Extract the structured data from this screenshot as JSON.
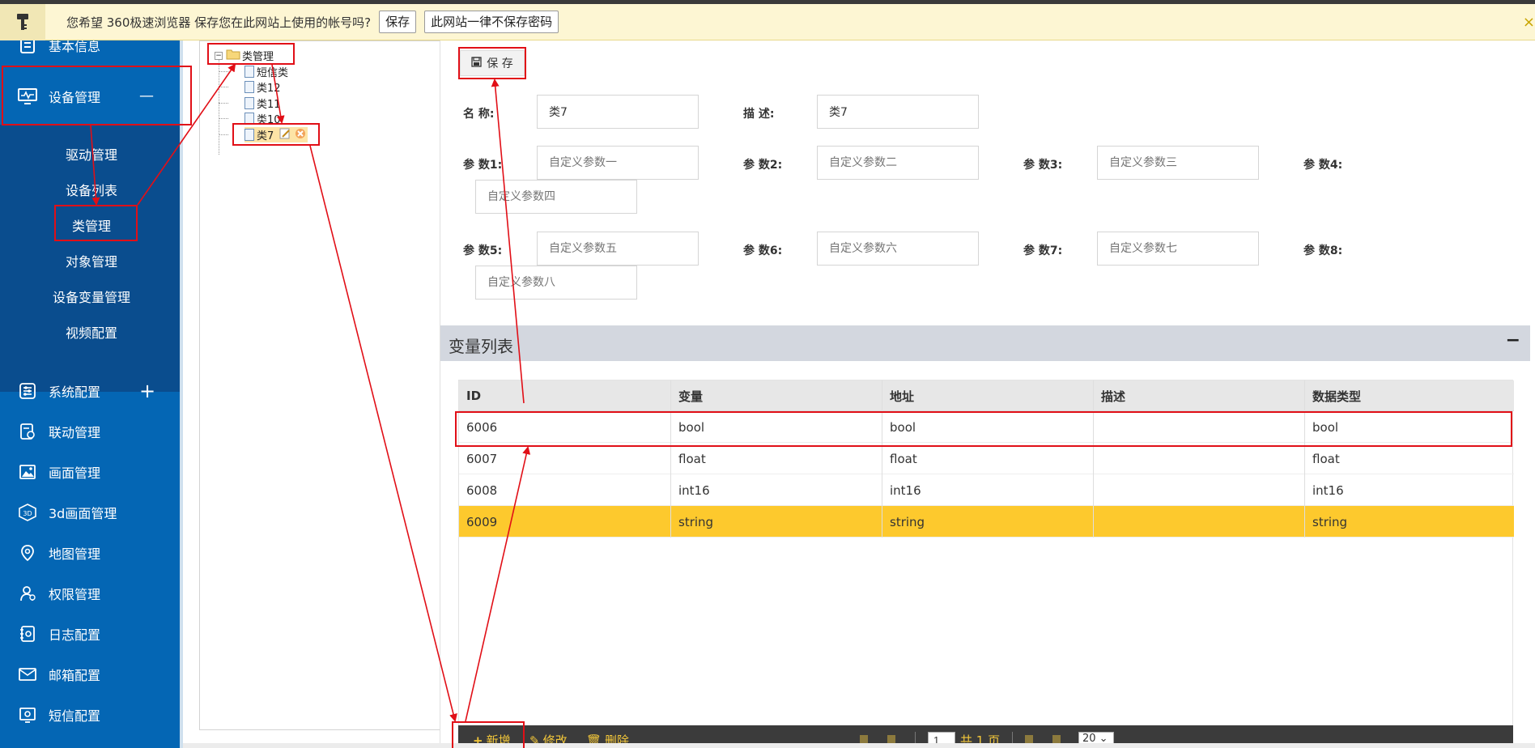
{
  "browser_bar": {
    "message": "您希望 360极速浏览器 保存您在此网站上使用的帐号吗?",
    "save_label": "保存",
    "never_label": "此网站一律不保存密码",
    "close_glyph": "×"
  },
  "sidebar": {
    "top_partial_label": "基本信息",
    "active_group": {
      "label": "设备管理",
      "sign": "—"
    },
    "sub_items": [
      "驱动管理",
      "设备列表",
      "类管理",
      "对象管理",
      "设备变量管理",
      "视频配置"
    ],
    "items": [
      {
        "label": "系统配置",
        "icon": "sliders-icon",
        "sign": "+"
      },
      {
        "label": "联动管理",
        "icon": "link-doc-icon"
      },
      {
        "label": "画面管理",
        "icon": "image-icon"
      },
      {
        "label": "3d画面管理",
        "icon": "3d-icon"
      },
      {
        "label": "地图管理",
        "icon": "map-pin-icon"
      },
      {
        "label": "权限管理",
        "icon": "user-shield-icon"
      },
      {
        "label": "日志配置",
        "icon": "log-gear-icon"
      },
      {
        "label": "邮箱配置",
        "icon": "mail-icon"
      },
      {
        "label": "短信配置",
        "icon": "sms-gear-icon"
      }
    ]
  },
  "tree": {
    "root": "类管理",
    "children": [
      "短信类",
      "类12",
      "类11",
      "类10",
      "类7"
    ]
  },
  "form": {
    "save_label": "保 存",
    "name_label": "名 称:",
    "name_value": "类7",
    "desc_label": "描 述:",
    "desc_value": "类7",
    "params": [
      {
        "label": "参 数1:",
        "placeholder": "自定义参数一"
      },
      {
        "label": "参 数2:",
        "placeholder": "自定义参数二"
      },
      {
        "label": "参 数3:",
        "placeholder": "自定义参数三"
      },
      {
        "label": "参 数4:",
        "placeholder": "自定义参数四"
      },
      {
        "label": "参 数5:",
        "placeholder": "自定义参数五"
      },
      {
        "label": "参 数6:",
        "placeholder": "自定义参数六"
      },
      {
        "label": "参 数7:",
        "placeholder": "自定义参数七"
      },
      {
        "label": "参 数8:",
        "placeholder": "自定义参数八"
      }
    ]
  },
  "var_panel": {
    "title": "变量列表",
    "collapse_glyph": "−",
    "columns": [
      "ID",
      "变量",
      "地址",
      "描述",
      "数据类型"
    ],
    "rows": [
      [
        "6006",
        "bool",
        "bool",
        "",
        "bool"
      ],
      [
        "6007",
        "float",
        "float",
        "",
        "float"
      ],
      [
        "6008",
        "int16",
        "int16",
        "",
        "int16"
      ],
      [
        "6009",
        "string",
        "string",
        "",
        "string"
      ]
    ],
    "selected_row": 3
  },
  "toolbar": {
    "add_label": "新增",
    "edit_label": "修改",
    "delete_label": "删除",
    "page_value": "1",
    "total_pages": "共 1 页",
    "page_size": "20"
  },
  "colors": {
    "sidebar_bg": "#0466b4",
    "sidebar_sub_bg": "#0a4d8e",
    "selected_row": "#fdc92d",
    "annotation_red": "#e10f17"
  }
}
